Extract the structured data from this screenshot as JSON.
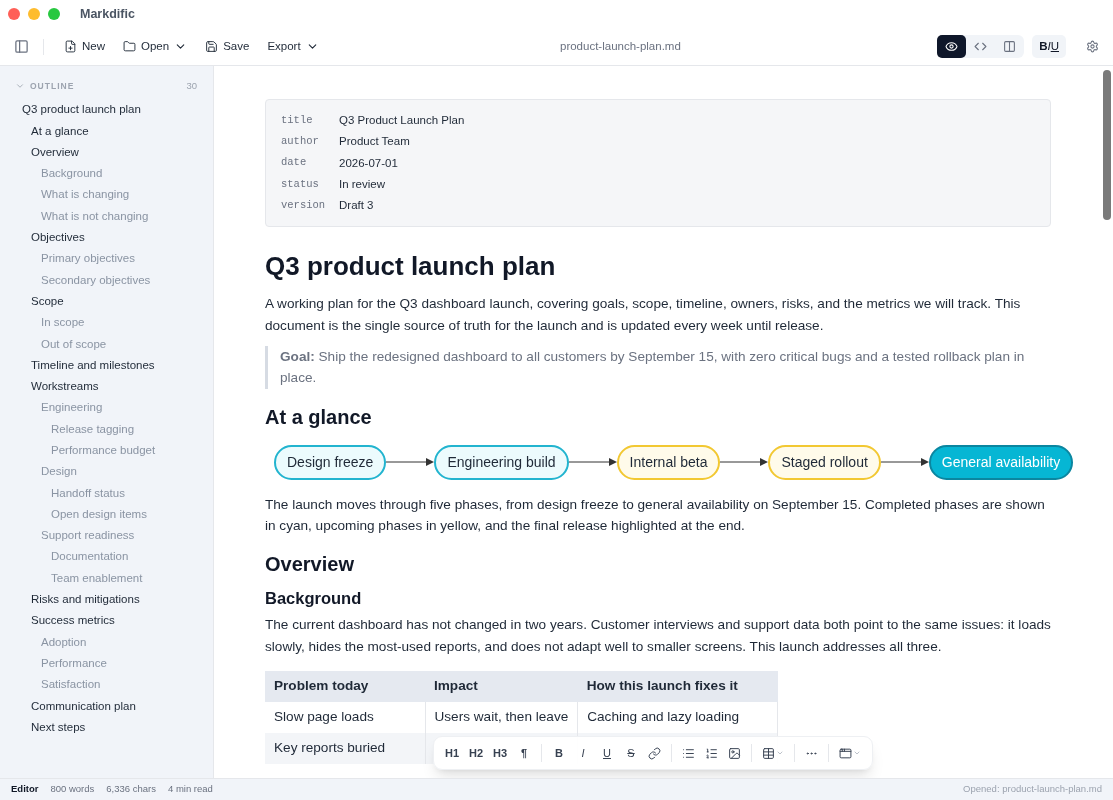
{
  "window": {
    "title": "Markdific"
  },
  "toolbar": {
    "buttons": [
      {
        "kind": "new",
        "label": "New"
      },
      {
        "kind": "open",
        "label": "Open",
        "dropdown": true
      },
      {
        "kind": "save",
        "label": "Save"
      },
      {
        "kind": "export",
        "label": "Export",
        "dropdown": true
      }
    ],
    "filename": "product-launch-plan.md",
    "view_modes": [
      {
        "kind": "preview",
        "selected": true
      },
      {
        "kind": "source",
        "selected": false
      },
      {
        "kind": "split",
        "selected": false
      }
    ],
    "format_toggle": [
      {
        "text": "B",
        "kind": "bold"
      },
      {
        "text": "I",
        "kind": "italic"
      },
      {
        "text": "U",
        "kind": "underline"
      }
    ]
  },
  "outline": {
    "title": "OUTLINE",
    "count": "30",
    "expanded": true,
    "items": [
      {
        "label": "Q3 product launch plan",
        "children": [
          {
            "label": "At a glance"
          },
          {
            "label": "Overview",
            "children": [
              {
                "label": "Background"
              },
              {
                "label": "What is changing"
              },
              {
                "label": "What is not changing"
              }
            ]
          },
          {
            "label": "Objectives",
            "children": [
              {
                "label": "Primary objectives"
              },
              {
                "label": "Secondary objectives"
              }
            ]
          },
          {
            "label": "Scope",
            "children": [
              {
                "label": "In scope"
              },
              {
                "label": "Out of scope"
              }
            ]
          },
          {
            "label": "Timeline and milestones"
          },
          {
            "label": "Workstreams",
            "children": [
              {
                "label": "Engineering",
                "children": [
                  {
                    "label": "Release tagging"
                  },
                  {
                    "label": "Performance budget"
                  }
                ]
              },
              {
                "label": "Design",
                "children": [
                  {
                    "label": "Handoff status"
                  },
                  {
                    "label": "Open design items"
                  }
                ]
              },
              {
                "label": "Support readiness",
                "children": [
                  {
                    "label": "Documentation"
                  },
                  {
                    "label": "Team enablement"
                  }
                ]
              }
            ]
          },
          {
            "label": "Risks and mitigations"
          },
          {
            "label": "Success metrics",
            "children": [
              {
                "label": "Adoption"
              },
              {
                "label": "Performance"
              },
              {
                "label": "Satisfaction"
              }
            ]
          },
          {
            "label": "Communication plan"
          },
          {
            "label": "Next steps"
          }
        ]
      }
    ]
  },
  "document": {
    "frontmatter": [
      {
        "key": "title",
        "value": "Q3 Product Launch Plan"
      },
      {
        "key": "author",
        "value": "Product Team"
      },
      {
        "key": "date",
        "value": "2026-07-01"
      },
      {
        "key": "status",
        "value": "In review"
      },
      {
        "key": "version",
        "value": "Draft 3"
      }
    ],
    "blocks": [
      {
        "kind": "h1",
        "text": "Q3 product launch plan"
      },
      {
        "kind": "p",
        "text": "A working plan for the Q3 dashboard launch, covering goals, scope, timeline, owners, risks, and the metrics we will track. This document is the single source of truth for the launch and is updated every week until release."
      },
      {
        "kind": "quote",
        "text": "**Goal:** Ship the redesigned dashboard to all customers by September 15, with zero critical bugs and a tested rollback plan in place."
      },
      {
        "kind": "h2",
        "text": "At a glance"
      },
      {
        "kind": "flow",
        "nodes": [
          {
            "label": "Design freeze",
            "kind": "done"
          },
          {
            "label": "Engineering build",
            "kind": "done"
          },
          {
            "label": "Internal beta",
            "kind": "upcoming"
          },
          {
            "label": "Staged rollout",
            "kind": "upcoming"
          },
          {
            "label": "General availability",
            "kind": "final"
          }
        ]
      },
      {
        "kind": "p",
        "text": "The launch moves through five phases, from design freeze to general availability on September 15. Completed phases are shown in cyan, upcoming phases in yellow, and the final release highlighted at the end."
      },
      {
        "kind": "h2",
        "text": "Overview"
      },
      {
        "kind": "h3",
        "text": "Background"
      },
      {
        "kind": "p",
        "text": "The current dashboard has not changed in two years. Customer interviews and support data both point to the same issues: it loads slowly, hides the most-used reports, and does not adapt well to smaller screens. This launch addresses all three."
      },
      {
        "kind": "table",
        "columns": [
          "Problem today",
          "Impact",
          "How this launch fixes it"
        ],
        "rows": [
          [
            "Slow page loads",
            "Users wait, then leave",
            "Caching and lazy loading"
          ],
          [
            "Key reports buried"
          ]
        ]
      }
    ]
  },
  "format_toolbar": {
    "groups": [
      [
        {
          "kind": "heading",
          "label": "H1"
        },
        {
          "kind": "heading",
          "label": "H2"
        },
        {
          "kind": "heading",
          "label": "H3"
        },
        {
          "kind": "heading",
          "label": "¶"
        }
      ],
      [
        {
          "kind": "bold",
          "label": "B"
        },
        {
          "kind": "italic",
          "label": "I"
        },
        {
          "kind": "underline",
          "label": "U"
        },
        {
          "kind": "strike",
          "label": "S"
        },
        {
          "kind": "link"
        }
      ],
      [
        {
          "kind": "bullet-list"
        },
        {
          "kind": "numbered-list"
        },
        {
          "kind": "image"
        }
      ],
      [
        {
          "kind": "table"
        }
      ],
      [
        {
          "kind": "more"
        }
      ],
      [
        {
          "kind": "layout"
        }
      ]
    ]
  },
  "status_bar": {
    "mode": "Editor",
    "stats": [
      "800 words",
      "6,336 chars",
      "4 min read"
    ],
    "message": "Opened: product-launch-plan.md"
  }
}
